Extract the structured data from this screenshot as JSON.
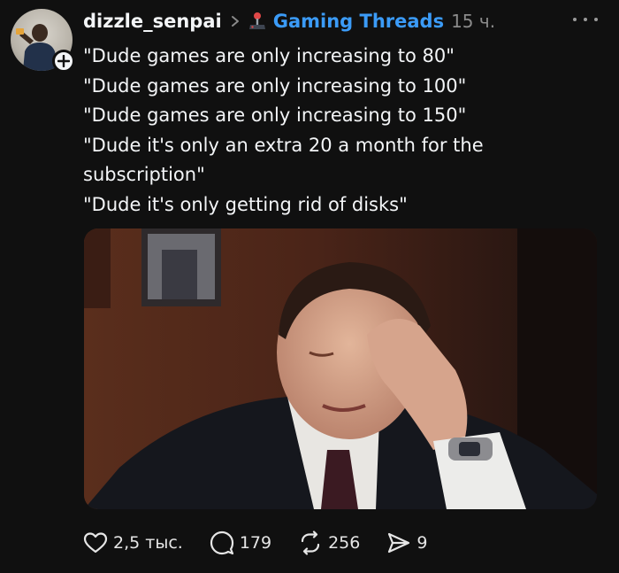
{
  "post": {
    "username": "dizzle_senpai",
    "community": "Gaming Threads",
    "time": "15 ч.",
    "lines": [
      "\"Dude games are only increasing to 80\"",
      "\"Dude games are only increasing to 100\"",
      "\"Dude games are only increasing to 150\"",
      "\"Dude it's only an extra 20 a month for the",
      "subscription\"",
      "\"Dude it's only getting rid of disks\""
    ]
  },
  "actions": {
    "likes": "2,5 тыс.",
    "replies": "179",
    "reposts": "256",
    "shares": "9"
  },
  "icons": {
    "avatar": "user-avatar",
    "follow": "plus-icon",
    "chevron": "chevron-right-icon",
    "community": "joystick-icon",
    "more": "more-icon",
    "like": "heart-icon",
    "reply": "comment-icon",
    "repost": "repost-icon",
    "share": "send-icon"
  },
  "colors": {
    "background": "#101010",
    "text": "#f3f5f7",
    "community_link": "#3b9bf7",
    "muted": "#8a8a8a"
  }
}
